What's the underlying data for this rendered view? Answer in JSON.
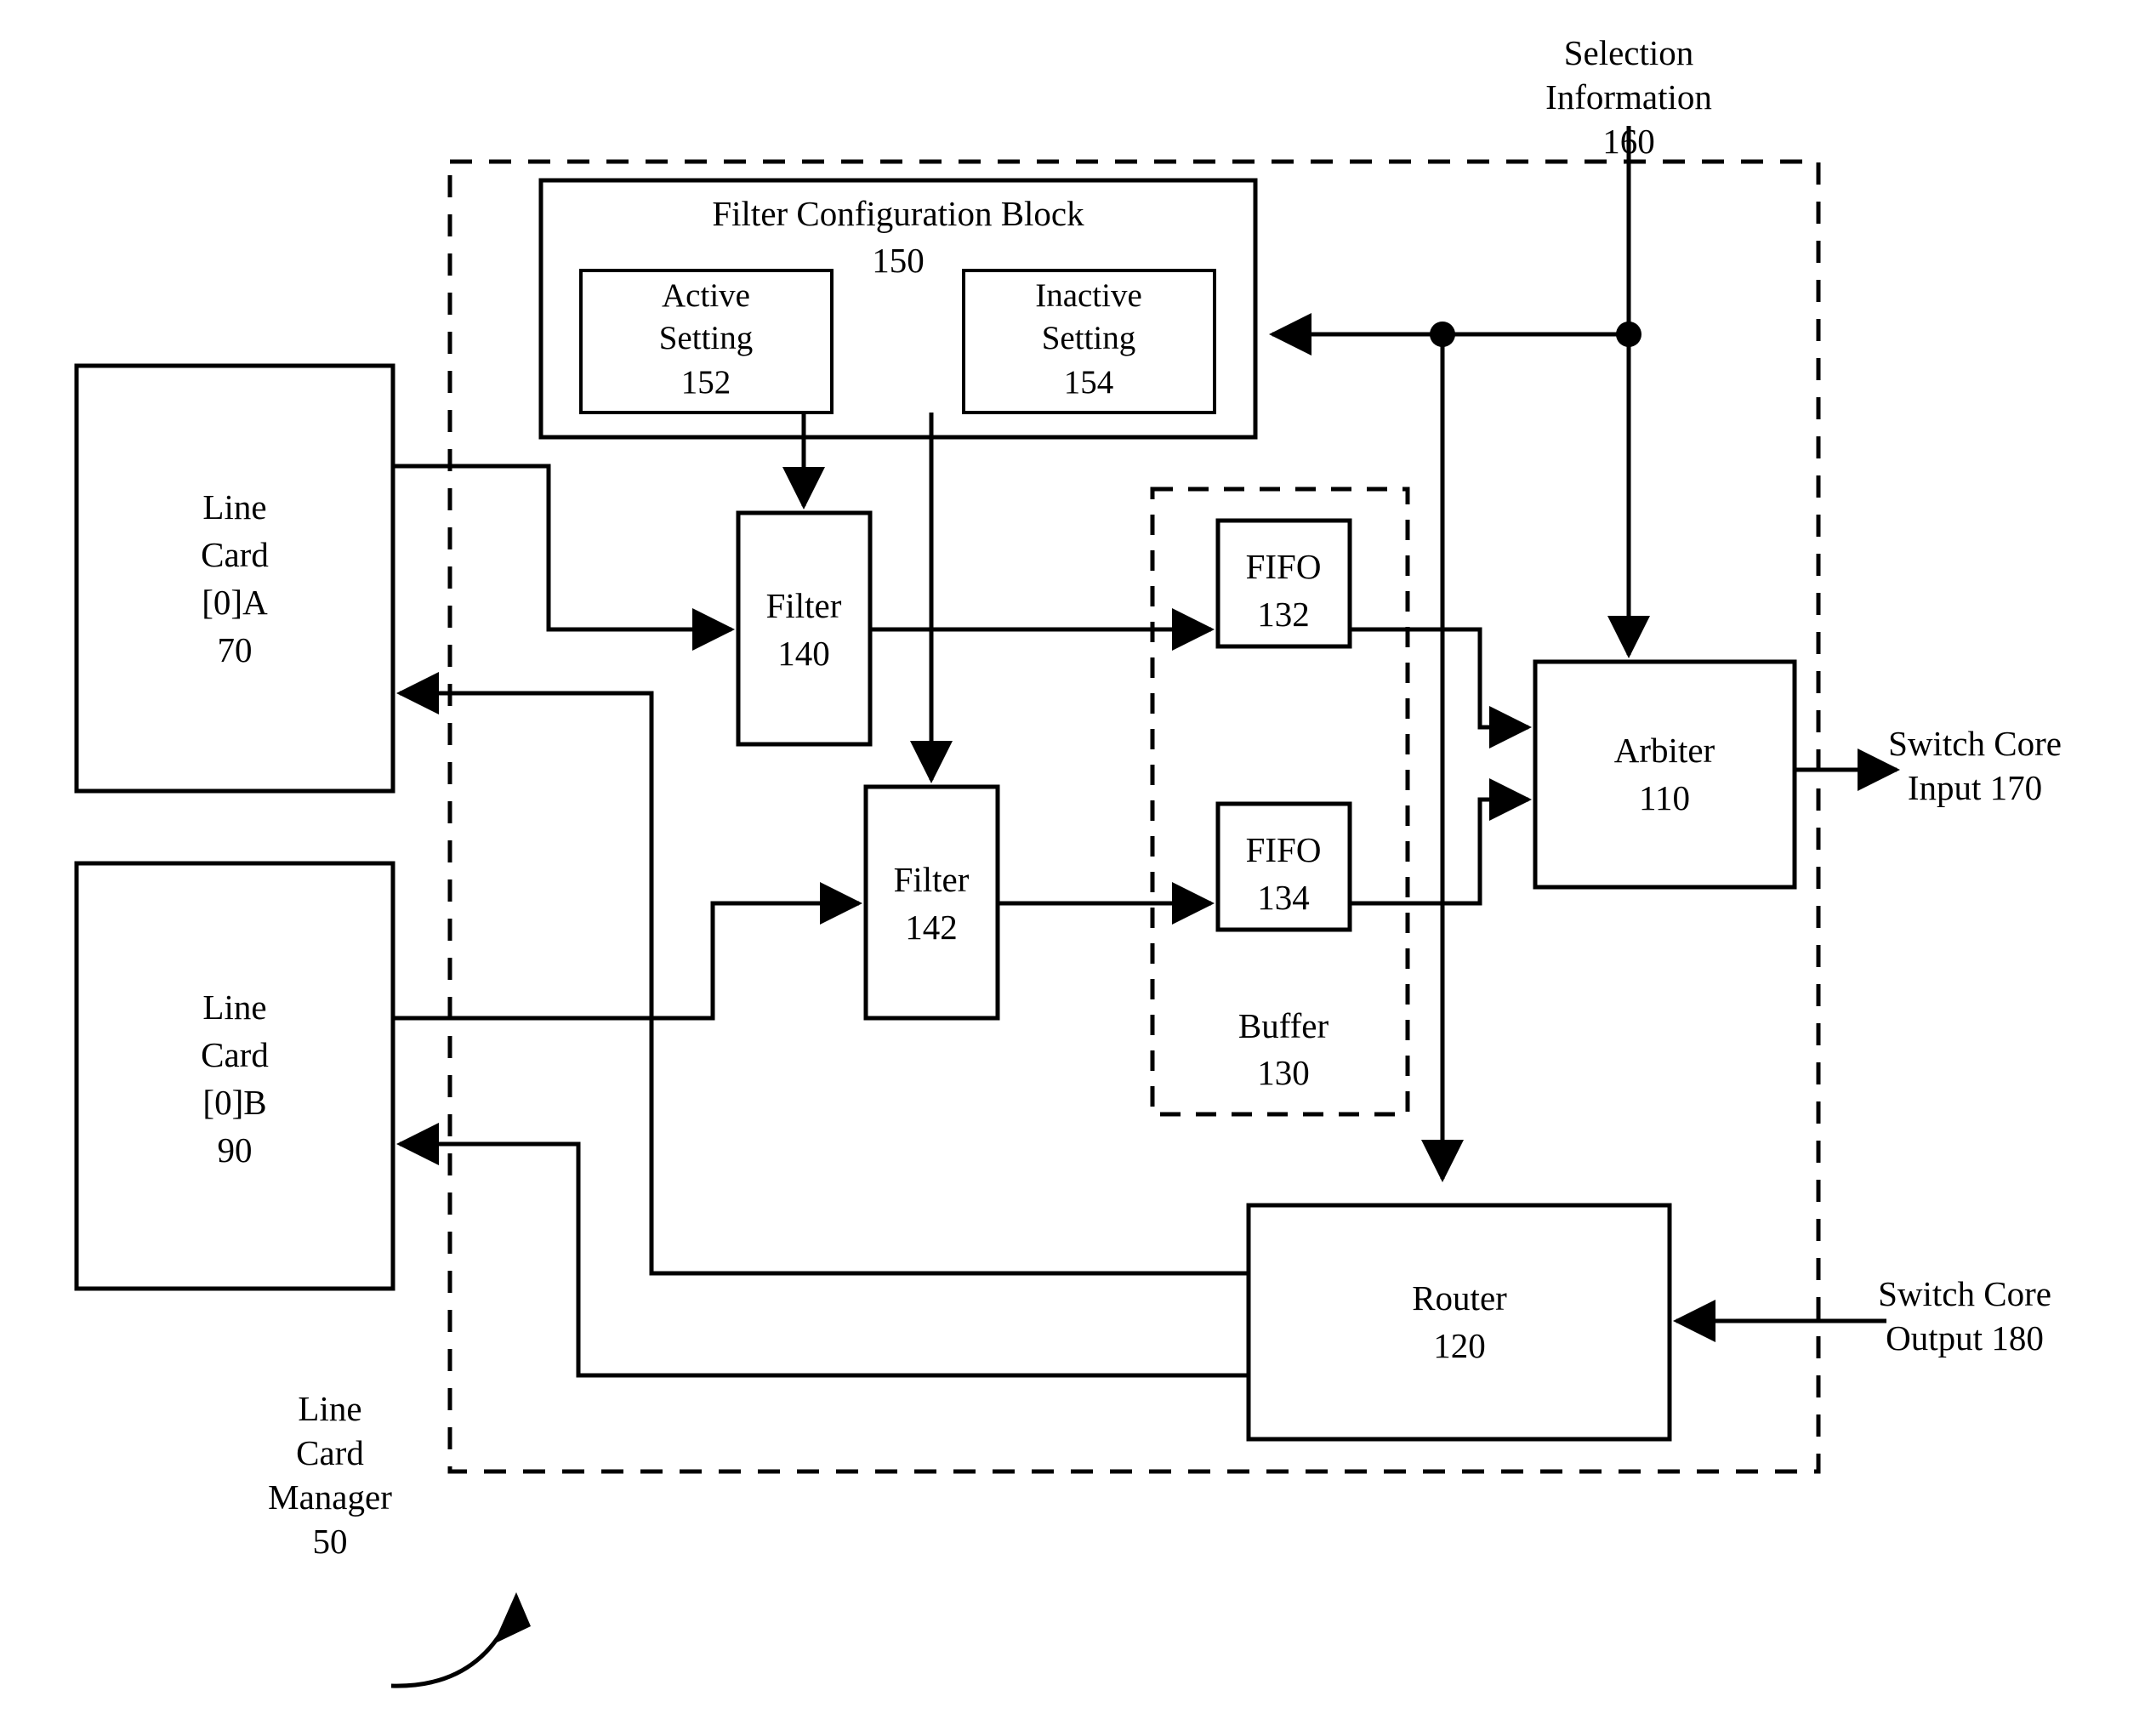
{
  "figure": {
    "title": "Line Card Manager Block Diagram",
    "domain": "patent-block-diagram"
  },
  "boundary": {
    "label_line1": "Line",
    "label_line2": "Card",
    "label_line3": "Manager",
    "label_ref": "50"
  },
  "blocks": {
    "line_card_a": {
      "line1": "Line",
      "line2": "Card",
      "line3": "[0]A",
      "ref": "70"
    },
    "line_card_b": {
      "line1": "Line",
      "line2": "Card",
      "line3": "[0]B",
      "ref": "90"
    },
    "filter_config": {
      "title": "Filter Configuration Block",
      "ref": "150"
    },
    "active_setting": {
      "line1": "Active",
      "line2": "Setting",
      "ref": "152"
    },
    "inactive_setting": {
      "line1": "Inactive",
      "line2": "Setting",
      "ref": "154"
    },
    "filter_140": {
      "name": "Filter",
      "ref": "140"
    },
    "filter_142": {
      "name": "Filter",
      "ref": "142"
    },
    "fifo_132": {
      "name": "FIFO",
      "ref": "132"
    },
    "fifo_134": {
      "name": "FIFO",
      "ref": "134"
    },
    "buffer": {
      "name": "Buffer",
      "ref": "130"
    },
    "arbiter": {
      "name": "Arbiter",
      "ref": "110"
    },
    "router": {
      "name": "Router",
      "ref": "120"
    }
  },
  "external": {
    "selection_information": {
      "line1": "Selection",
      "line2": "Information",
      "ref": "160"
    },
    "switch_core_input": {
      "line1": "Switch Core",
      "line2": "Input 170"
    },
    "switch_core_output": {
      "line1": "Switch Core",
      "line2": "Output 180"
    }
  },
  "colors": {
    "stroke": "#000000",
    "fill": "#ffffff"
  }
}
